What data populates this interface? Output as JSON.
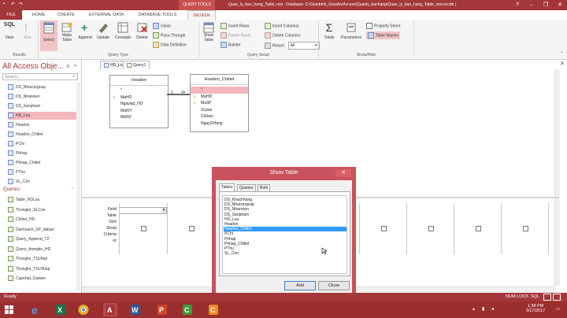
{
  "window": {
    "contextual_tab_group": "QUERY TOOLS",
    "title": "Quan_ly_ban_hang_Table_moi : Database- D:\\Giaotrinh_GiaoAn\\Access\\Quanly_banhang\\Quan_ly_ban_hang_Table_moi.accdb (",
    "buttons": [
      "?",
      "–",
      "❐",
      "✕"
    ]
  },
  "ribbon_tabs": [
    "FILE",
    "HOME",
    "CREATE",
    "EXTERNAL DATA",
    "DATABASE TOOLS",
    "DESIGN"
  ],
  "ribbon": {
    "results": {
      "view": "View",
      "run": "Run",
      "group": "Results",
      "view_icon_text": "SQL"
    },
    "query_type": {
      "select": "Select",
      "make_table": "Make Table",
      "append": "Append",
      "update": "Update",
      "crosstab": "Crosstab",
      "delete": "Delete",
      "union": "Union",
      "pass_through": "Pass-Through",
      "data_definition": "Data Definition",
      "group": "Query Type"
    },
    "query_setup": {
      "show_table": "Show Table",
      "insert_rows": "Insert Rows",
      "delete_rows": "Delete Rows",
      "builder": "Builder",
      "insert_columns": "Insert Columns",
      "delete_columns": "Delete Columns",
      "return_label": "Return:",
      "return_value": "All",
      "group": "Query Setup"
    },
    "show_hide": {
      "totals": "Totals",
      "parameters": "Parameters",
      "property_sheet": "Property Sheet",
      "table_names": "Table Names",
      "group": "Show/Hide"
    }
  },
  "nav": {
    "header": "All Access Obje...",
    "search_placeholder": "Search...",
    "tables": [
      "DS_Nhacungcap",
      "DS_Nhanvien",
      "DS_Sanpham",
      "HD_Luu",
      "Hoadon",
      "Hoadon_Chitiet",
      "PChi",
      "Phhap",
      "Phhap_Chitiet",
      "PThu",
      "SL_Con"
    ],
    "queries_label": "Queries",
    "queries": [
      "Table_HDLuu",
      "Thongke_SLCon",
      "Chitiet_HD",
      "Danhsach_SP_daban",
      "Query_Append_T2",
      "Query_thongke_HD",
      "Thongke_TSLBan",
      "Thongke_TSLNhap",
      "Capnhat_Giaban"
    ]
  },
  "doc_tabs": [
    "HD_Luu",
    "Query1"
  ],
  "design": {
    "table1": {
      "title": "Hoadon",
      "fields": [
        "*",
        "MaHD",
        "Ngaylap_HD",
        "MaKH",
        "MaNV"
      ]
    },
    "table2": {
      "title": "Hoadon_Chitiet",
      "fields": [
        "*",
        "MaHD",
        "MaSP",
        "SLban",
        "DGban",
        "NgayGHang"
      ]
    },
    "join_left": "1",
    "join_right": "∞"
  },
  "grid": {
    "row_labels": [
      "Field:",
      "Table:",
      "Sort:",
      "Show:",
      "Criteria:",
      "or:"
    ]
  },
  "dialog": {
    "title": "Show Table",
    "tabs": [
      "Tables",
      "Queries",
      "Both"
    ],
    "items": [
      "DS_Khachhang",
      "DS_Nhacungcap",
      "DS_Nhanvien",
      "DS_Sanpham",
      "HD_Luu",
      "Hoadon",
      "Hoadon_Chitiet",
      "PChi",
      "Phhap",
      "Phhap_Chitiet",
      "PThu",
      "SL_Con"
    ],
    "selected_index": 6,
    "add_label": "Add",
    "close_label": "Close"
  },
  "status": {
    "left": "Ready",
    "num_lock": "NUM LOCK",
    "sql": "SQL"
  },
  "taskbar": {
    "time": "1:38 PM",
    "date": "3/17/2017"
  },
  "colors": {
    "accent": "#a4373a",
    "selection": "#f2b7bc",
    "list_selection": "#3399ff"
  }
}
